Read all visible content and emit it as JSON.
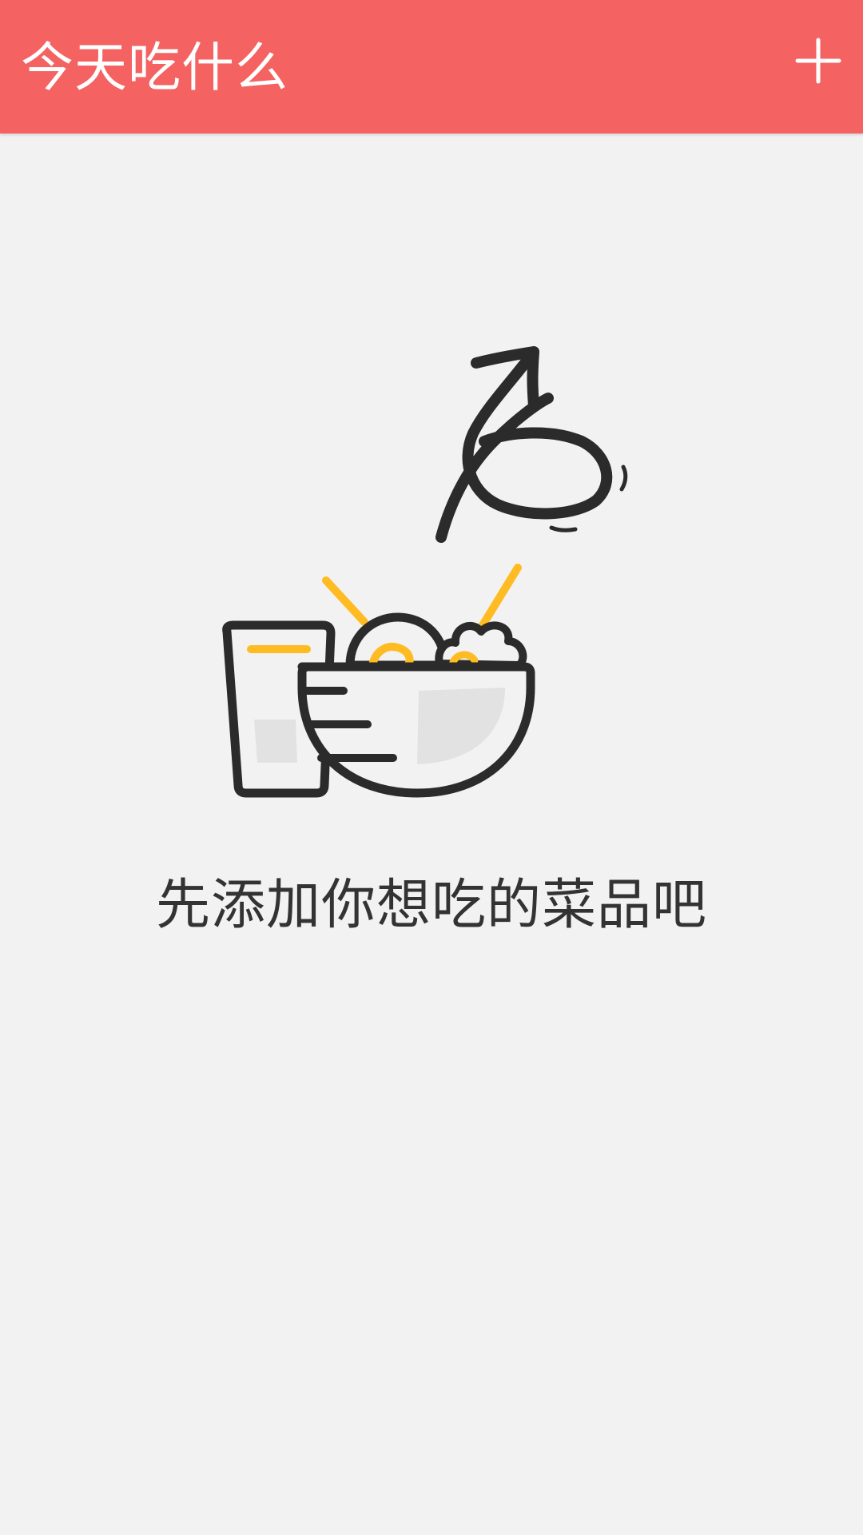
{
  "app": {
    "title": "今天吃什么",
    "accent_color": "#f46262",
    "background_color": "#f2f2f3"
  },
  "toolbar": {
    "add_icon": "plus-icon"
  },
  "empty_state": {
    "illustration_icon": "food-bowl-with-arrow-icon",
    "message": "先添加你想吃的菜品吧",
    "line_color": "#2b2b2b",
    "highlight_color": "#ffbb22",
    "fill_color": "#e2e2e2"
  }
}
